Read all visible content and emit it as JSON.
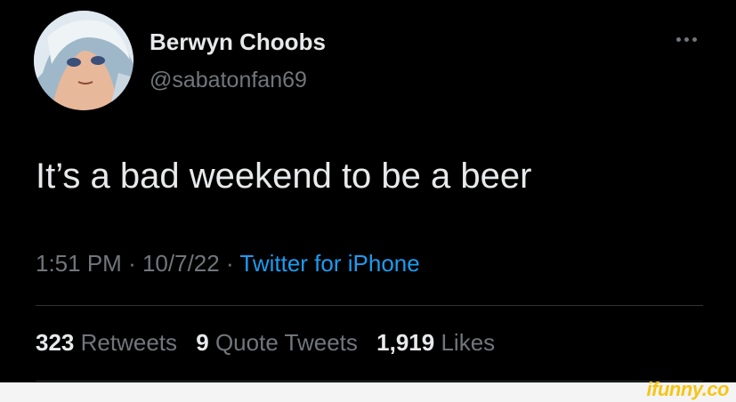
{
  "tweet": {
    "author": {
      "name": "Berwyn Choobs",
      "handle": "@sabatonfan69"
    },
    "text": "It’s a bad weekend to be a beer",
    "time": "1:51 PM",
    "date": "10/7/22",
    "separator": "·",
    "source": "Twitter for iPhone",
    "stats": {
      "retweets_count": "323",
      "retweets_label": "Retweets",
      "quote_tweets_count": "9",
      "quote_tweets_label": "Quote Tweets",
      "likes_count": "1,919",
      "likes_label": "Likes"
    }
  },
  "watermark": "ifunny.co",
  "colors": {
    "background": "#000000",
    "text_primary": "#e7e9ea",
    "text_secondary": "#71767b",
    "link": "#1d9bf0",
    "divider": "#2f3336",
    "watermark": "#f5c518"
  },
  "icons": {
    "more": "more-horizontal-icon",
    "avatar": "avatar-image"
  }
}
